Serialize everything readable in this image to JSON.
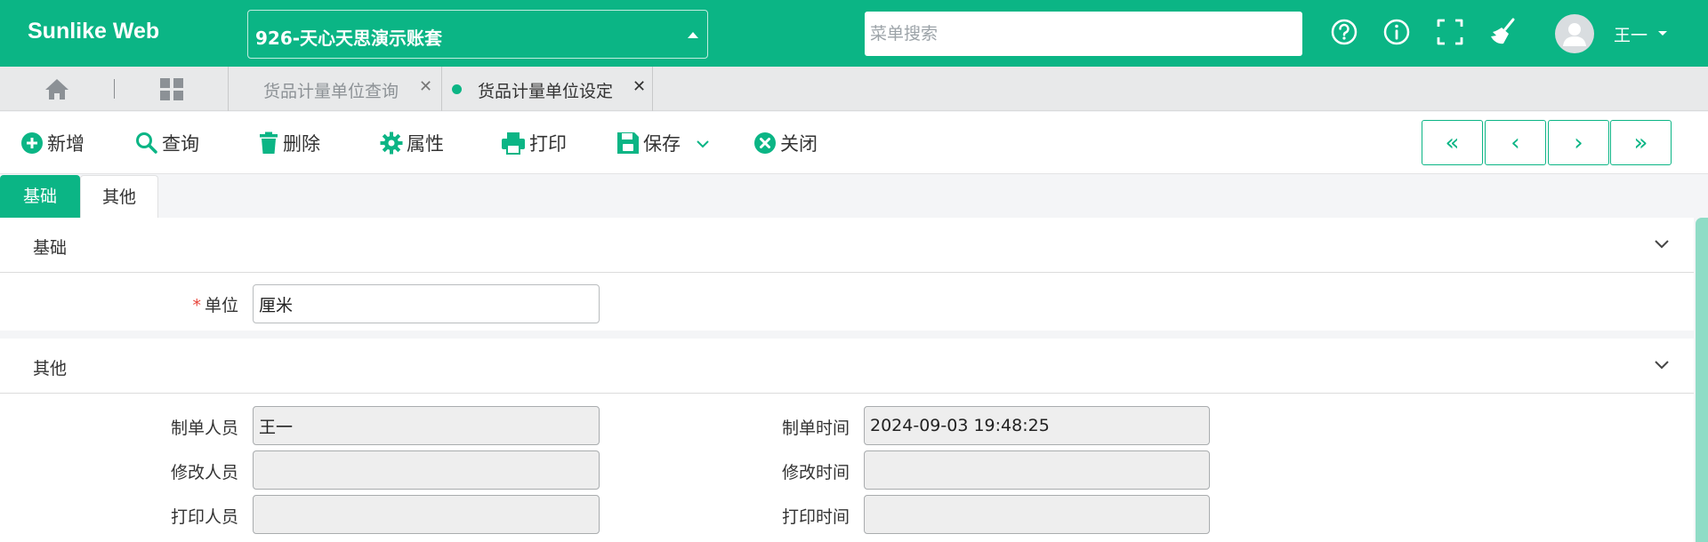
{
  "header": {
    "brand": "Sunlike Web",
    "account": "926-天心天思演示账套",
    "search_placeholder": "菜单搜索",
    "user": "王一",
    "icons": [
      "help-icon",
      "info-icon",
      "fullscreen-icon",
      "broom-icon"
    ]
  },
  "tabs": [
    {
      "label": "货品计量单位查询",
      "active": false
    },
    {
      "label": "货品计量单位设定",
      "active": true
    }
  ],
  "toolbar": {
    "new": "新增",
    "query": "查询",
    "delete": "删除",
    "properties": "属性",
    "print": "打印",
    "save": "保存",
    "close": "关闭",
    "nav": [
      "«",
      "‹",
      "›",
      "»"
    ]
  },
  "form_tabs": [
    "基础",
    "其他"
  ],
  "sections": {
    "basic": {
      "title": "基础",
      "unit_label": "单位",
      "unit_value": "厘米"
    },
    "other": {
      "title": "其他",
      "creator_label": "制单人员",
      "creator_value": "王一",
      "create_time_label": "制单时间",
      "create_time_value": "2024-09-03 19:48:25",
      "modifier_label": "修改人员",
      "modifier_value": "",
      "modify_time_label": "修改时间",
      "modify_time_value": "",
      "printer_label": "打印人员",
      "printer_value": "",
      "print_time_label": "打印时间",
      "print_time_value": ""
    }
  },
  "colors": {
    "accent": "#0bb585",
    "required": "#e8443a"
  }
}
